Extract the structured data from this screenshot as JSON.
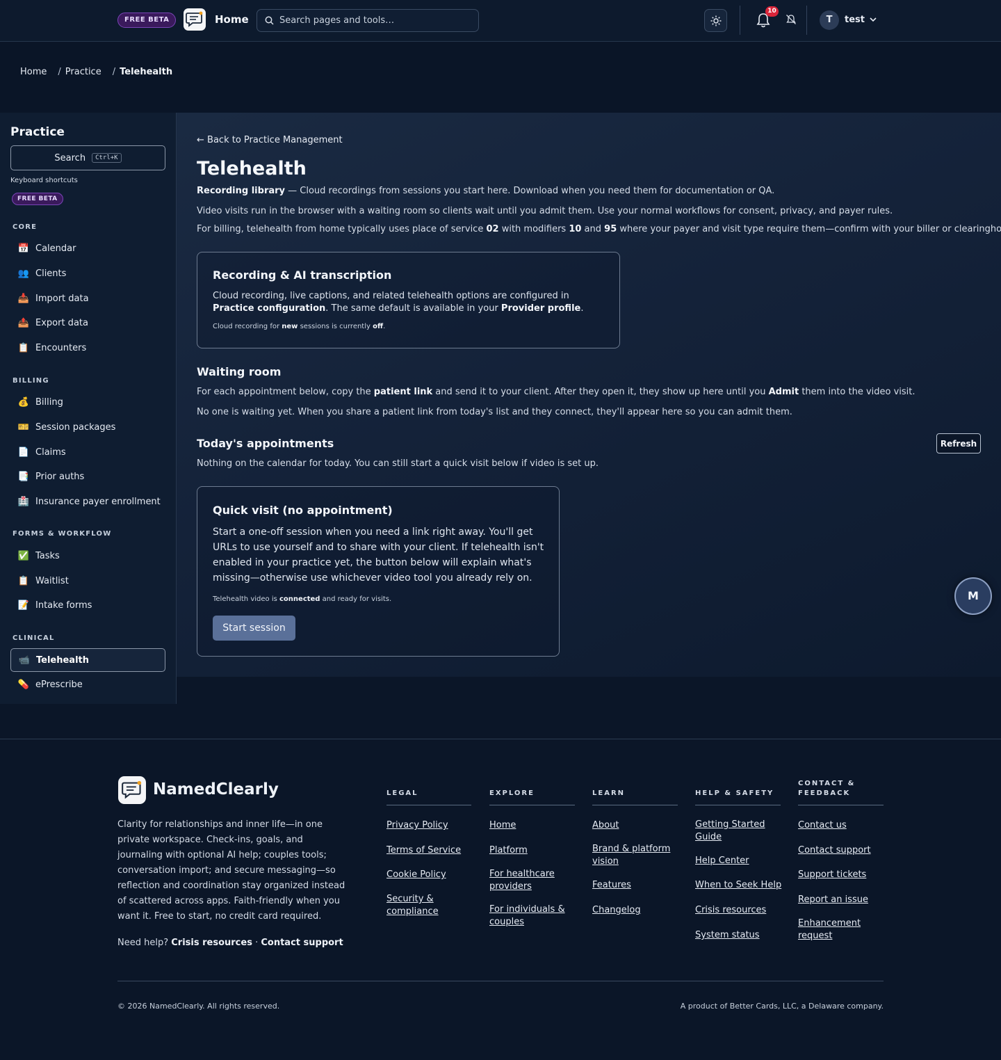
{
  "topbar": {
    "beta_badge": "FREE BETA",
    "title": "Home",
    "search_placeholder": "Search pages and tools…",
    "notifications_count": "10",
    "user_initial": "T",
    "user_name": "test"
  },
  "breadcrumb": {
    "items": [
      "Home",
      "Practice",
      "Telehealth"
    ],
    "separator": "/"
  },
  "sidebar": {
    "title": "Practice",
    "search_label": "Search",
    "search_shortcut": "Ctrl+K",
    "keyboard_shortcuts": "Keyboard shortcuts",
    "beta_badge": "FREE BETA",
    "sections": {
      "core": "CORE",
      "billing": "BILLING",
      "forms": "FORMS & WORKFLOW",
      "clinical": "CLINICAL"
    },
    "items": {
      "calendar": "Calendar",
      "clients": "Clients",
      "import": "Import data",
      "export": "Export data",
      "encounters": "Encounters",
      "billing": "Billing",
      "packages": "Session packages",
      "claims": "Claims",
      "prior": "Prior auths",
      "payer": "Insurance payer enrollment",
      "tasks": "Tasks",
      "waitlist": "Waitlist",
      "intake": "Intake forms",
      "telehealth": "Telehealth",
      "eprescribe": "ePrescribe"
    }
  },
  "main": {
    "back_link": "Back to Practice Management",
    "title": "Telehealth",
    "recording_library_label": "Recording library",
    "recording_library_text": " — Cloud recordings from sessions you start here. Download when you need them for documentation or QA.",
    "intro": "Video visits run in the browser with a waiting room so clients wait until you admit them. Use your normal workflows for consent, privacy, and payer rules.",
    "billing": {
      "t1": "For billing, telehealth from home typically uses place of service ",
      "pos": "02",
      "t2": " with modifiers ",
      "mod1": "10",
      "t3": " and ",
      "mod2": "95",
      "t4": " where your payer and visit type require them—confirm with your biller or clearinghouse."
    },
    "recording_card": {
      "title": "Recording & AI transcription",
      "t1": "Cloud recording, live captions, and related telehealth options are configured in ",
      "b1": "Practice configuration",
      "t2": ". The same default is available in your ",
      "b2": "Provider profile",
      "t3": ".",
      "s1": "Cloud recording for ",
      "sb1": "new",
      "s2": " sessions is currently ",
      "sb2": "off",
      "s3": "."
    },
    "waiting_room": {
      "title": "Waiting room",
      "t1": "For each appointment below, copy the ",
      "b1": "patient link",
      "t2": " and send it to your client. After they open it, they show up here until you ",
      "b2": "Admit",
      "t3": " them into the video visit.",
      "empty": "No one is waiting yet. When you share a patient link from today's list and they connect, they'll appear here so you can admit them."
    },
    "appointments": {
      "title": "Today's appointments",
      "refresh": "Refresh",
      "empty": "Nothing on the calendar for today. You can still start a quick visit below if video is set up."
    },
    "quick_visit": {
      "title": "Quick visit (no appointment)",
      "text": "Start a one-off session when you need a link right away. You'll get URLs to use yourself and to share with your client. If telehealth isn't enabled in your practice yet, the button below will explain what's missing—otherwise use whichever video tool you already rely on.",
      "s1": "Telehealth video is ",
      "sb": "connected",
      "s2": " and ready for visits.",
      "button": "Start session"
    },
    "fab_initial": "M"
  },
  "footer": {
    "brand": "NamedClearly",
    "description": "Clarity for relationships and inner life—in one private workspace. Check-ins, goals, and journaling with optional AI help; couples tools; conversation import; and secure messaging—so reflection and coordination stay organized instead of scattered across apps. Faith-friendly when you want it. Free to start, no credit card required.",
    "help_prefix": "Need help? ",
    "help_crisis": "Crisis resources",
    "help_dot": " · ",
    "help_contact": "Contact support",
    "columns": {
      "legal": {
        "heading": "LEGAL",
        "links": [
          "Privacy Policy",
          "Terms of Service",
          "Cookie Policy",
          "Security & compliance"
        ]
      },
      "explore": {
        "heading": "EXPLORE",
        "links": [
          "Home",
          "Platform",
          "For healthcare providers",
          "For individuals & couples"
        ]
      },
      "learn": {
        "heading": "LEARN",
        "links": [
          "About",
          "Brand & platform vision",
          "Features",
          "Changelog"
        ]
      },
      "help": {
        "heading": "HELP & SAFETY",
        "links": [
          "Getting Started Guide",
          "Help Center",
          "When to Seek Help",
          "Crisis resources",
          "System status"
        ]
      },
      "contact": {
        "heading": "CONTACT & FEEDBACK",
        "links": [
          "Contact us",
          "Contact support",
          "Support tickets",
          "Report an issue",
          "Enhancement request"
        ]
      }
    },
    "copyright": "© 2026 NamedClearly. All rights reserved.",
    "product": "A product of Better Cards, LLC, a Delaware company."
  }
}
